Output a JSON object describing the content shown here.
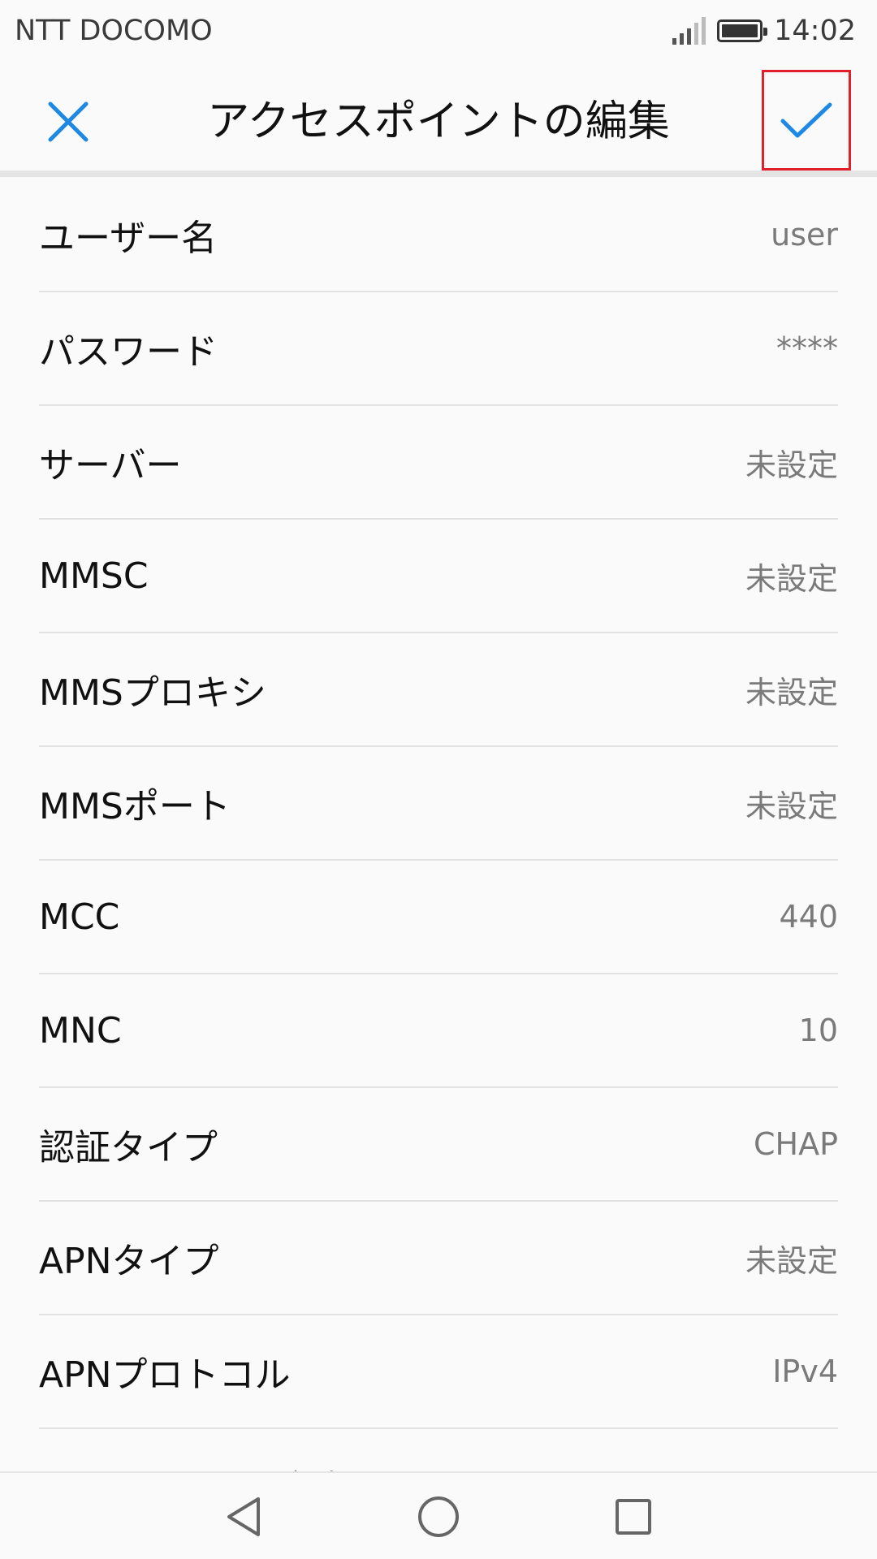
{
  "status_bar": {
    "carrier": "NTT DOCOMO",
    "time": "14:02",
    "signal_icon": "signal-icon",
    "battery_icon": "battery-icon"
  },
  "app_bar": {
    "title": "アクセスポイントの編集",
    "close_icon": "close-icon",
    "confirm_icon": "check-icon",
    "accent_color": "#1e88e5",
    "highlight_color": "#e0202a"
  },
  "settings": [
    {
      "label": "ユーザー名",
      "value": "user"
    },
    {
      "label": "パスワード",
      "value": "****"
    },
    {
      "label": "サーバー",
      "value": "未設定"
    },
    {
      "label": "MMSC",
      "value": "未設定"
    },
    {
      "label": "MMSプロキシ",
      "value": "未設定"
    },
    {
      "label": "MMSポート",
      "value": "未設定"
    },
    {
      "label": "MCC",
      "value": "440"
    },
    {
      "label": "MNC",
      "value": "10"
    },
    {
      "label": "認証タイプ",
      "value": "CHAP"
    },
    {
      "label": "APNタイプ",
      "value": "未設定"
    },
    {
      "label": "APNプロトコル",
      "value": "IPv4"
    }
  ],
  "partial_row_label": "ミングプロトコル",
  "nav_bar": {
    "back_icon": "back-icon",
    "home_icon": "home-icon",
    "recents_icon": "recents-icon"
  }
}
